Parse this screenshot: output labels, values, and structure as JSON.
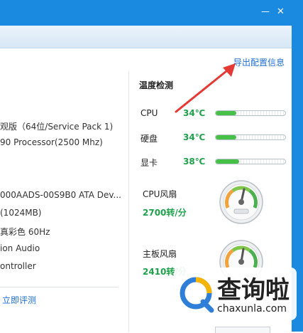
{
  "window": {
    "minimize_glyph": "—",
    "close_glyph": "✕",
    "accent_color": "#1a89e0"
  },
  "system_info": {
    "lines": [
      "观版（64位/Service Pack 1)",
      "90 Processor(2500 Mhz)",
      "000AADS-00S9B0 ATA Dev...",
      "(1024MB)",
      "真彩色 60Hz",
      "ion Audio",
      "ontroller"
    ],
    "evaluate_link": "立即评测"
  },
  "export_link": "导出配置信息",
  "temperature": {
    "title": "温度检测",
    "items": [
      {
        "label": "CPU",
        "value": "34℃",
        "level": 0.3
      },
      {
        "label": "硬盘",
        "value": "34℃",
        "level": 0.3
      },
      {
        "label": "显卡",
        "value": "38℃",
        "level": 0.34
      }
    ]
  },
  "fans": [
    {
      "label": "CPU风扇",
      "value": "2700转/分"
    },
    {
      "label": "主板风扇",
      "value": "2410转/分"
    }
  ],
  "watermark": {
    "title": "查询啦",
    "subtitle": "chaxunla.com"
  },
  "colors": {
    "link": "#1f6fd1",
    "temp_value": "#1ea14a",
    "arrow": "#e53935"
  }
}
